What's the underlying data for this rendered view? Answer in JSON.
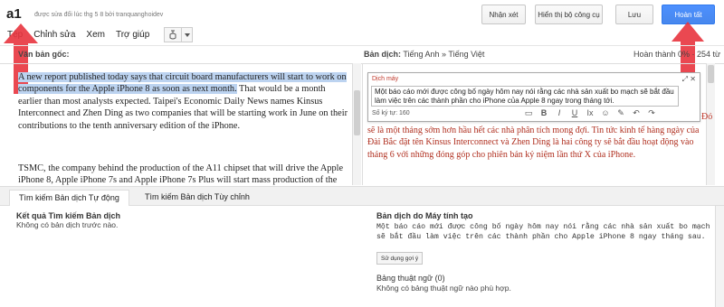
{
  "header": {
    "title": "a1",
    "subtitle": "được sửa đổi lúc thg 5 8 bởi tranquanghoidev",
    "menu": [
      "Tệp",
      "Chỉnh sửa",
      "Xem",
      "Trợ giúp"
    ],
    "buttons": {
      "comment": "Nhận xét",
      "show_toolkit": "Hiển thị bộ công cụ",
      "save": "Lưu",
      "done": "Hoàn tất"
    }
  },
  "source": {
    "label": "Văn bản gốc:",
    "highlighted": "A new report published today says that circuit board manufacturers will start to work on components for the Apple iPhone 8 as soon as next month.",
    "rest": " That would be a month earlier than most analysts expected. Taipei's Economic Daily News names Kinsus Interconnect and Zhen Ding as two companies that will be starting work in June on their contributions to the tenth anniversary edition of the iPhone.",
    "para2": "TSMC, the company behind the production of the A11 chipset that will drive the Apple iPhone 8, Apple iPhone 7s and Apple iPhone 7s Plus will start mass production of the new chips in July. Even with the board start by some suppliers, the supply chain"
  },
  "target": {
    "label_prefix": "Bản dịch:",
    "label_langs": "Tiếng Anh » Tiếng Việt",
    "progress": "Hoàn thành 0% · 254 từ",
    "mt_title": "Dịch máy",
    "mt_text": "Một báo cáo mới được công bố ngày hôm nay nói rằng các nhà sản xuất bo mạch sẽ bắt đầu làm việc trên các thành phần cho iPhone của Apple 8 ngay trong tháng tới.",
    "char_count": "Số ký tự: 160",
    "side_red": "Đó",
    "translated": "sẽ là một tháng sớm hơn hầu hết các nhà phân tích mong đợi. Tin tức kinh tế hàng ngày của Đài Bắc đặt tên Kinsus Interconnect và Zhen Ding là hai công ty sẽ bắt đầu hoạt động vào tháng 6 với những đóng góp cho phiên bản kỷ niệm lần thứ X của iPhone."
  },
  "bottom": {
    "tabs": [
      "Tìm kiếm Bản dịch Tự động",
      "Tìm kiếm Bản dịch Tùy chỉnh"
    ],
    "left_title": "Kết quả Tìm kiếm Bản dịch",
    "left_text": "Không có bản dịch trước nào.",
    "right_title": "Bản dịch do Máy tính tạo",
    "right_text": "Một báo cáo mới được công bố ngày hôm nay nói rằng các nhà sản xuất bo mạch sẽ bắt đầu làm việc trên các thành phần cho Apple iPhone 8 ngay tháng sau.",
    "suggest_button": "Sử dụng gợi ý",
    "glossary_title": "Bảng thuật ngữ (0)",
    "glossary_text": "Không có bảng thuật ngữ nào phù hợp."
  },
  "colors": {
    "primary": "#4787ed",
    "highlight": "#bcd3f0",
    "translation_red": "#b03020",
    "arrow_red": "#e8343e"
  }
}
